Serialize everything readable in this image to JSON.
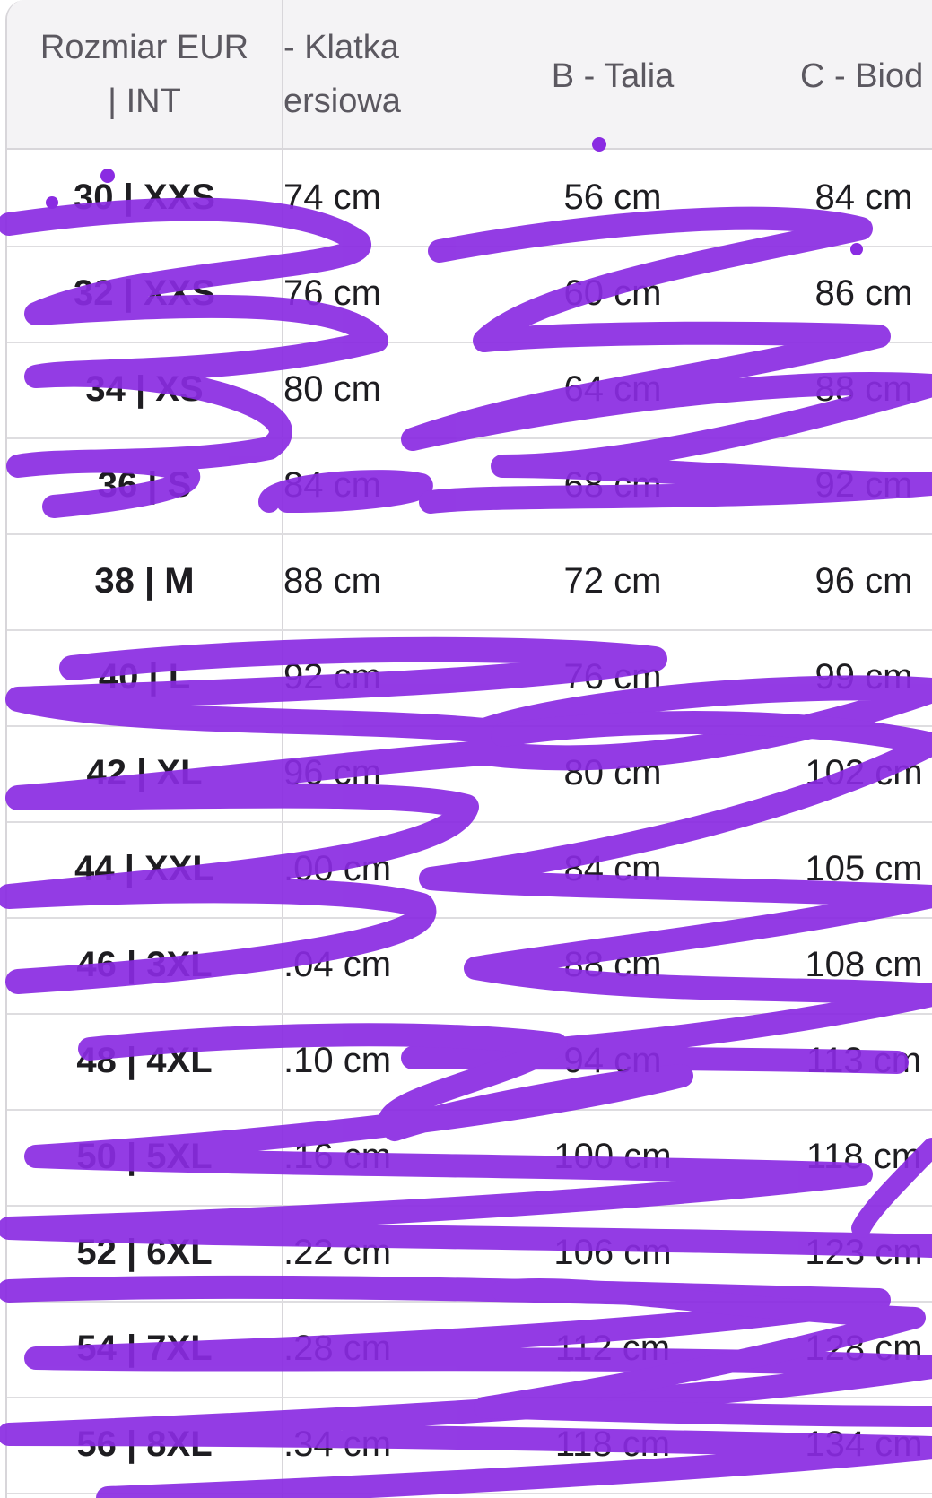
{
  "table": {
    "headers": [
      "Rozmiar EUR | INT",
      "- Klatka\nersiowa",
      "B - Talia",
      "C - Biod"
    ],
    "header_lines": {
      "col0": [
        "Rozmiar EUR",
        "| INT"
      ],
      "col1": [
        "- Klatka",
        "ersiowa"
      ],
      "col2": "B - Talia",
      "col3": "C - Biod"
    },
    "rows": [
      {
        "size": "30 | XXS",
        "chest": "74 cm",
        "waist": "56 cm",
        "hips": "84 cm"
      },
      {
        "size": "32 | XXS",
        "chest": "76 cm",
        "waist": "60 cm",
        "hips": "86 cm"
      },
      {
        "size": "34 | XS",
        "chest": "80 cm",
        "waist": "64 cm",
        "hips": "88 cm"
      },
      {
        "size": "36 | S",
        "chest": "84 cm",
        "waist": "68 cm",
        "hips": "92 cm"
      },
      {
        "size": "38 | M",
        "chest": "88 cm",
        "waist": "72 cm",
        "hips": "96 cm"
      },
      {
        "size": "40 | L",
        "chest": "92 cm",
        "waist": "76 cm",
        "hips": "99 cm"
      },
      {
        "size": "42 | XL",
        "chest": "96 cm",
        "waist": "80 cm",
        "hips": "102 cm"
      },
      {
        "size": "44 | XXL",
        "chest": ".00 cm",
        "waist": "84 cm",
        "hips": "105 cm"
      },
      {
        "size": "46 | 3XL",
        "chest": ".04 cm",
        "waist": "88 cm",
        "hips": "108 cm"
      },
      {
        "size": "48 | 4XL",
        "chest": ".10 cm",
        "waist": "94 cm",
        "hips": "113 cm"
      },
      {
        "size": "50 | 5XL",
        "chest": ".16 cm",
        "waist": "100 cm",
        "hips": "118 cm"
      },
      {
        "size": "52 | 6XL",
        "chest": ".22 cm",
        "waist": "106 cm",
        "hips": "123 cm"
      },
      {
        "size": "54 | 7XL",
        "chest": ".28 cm",
        "waist": "112 cm",
        "hips": "128 cm"
      },
      {
        "size": "56 | 8XL",
        "chest": ".34 cm",
        "waist": "118 cm",
        "hips": "134 cm"
      }
    ]
  },
  "colors": {
    "header_bg": "#f4f3f5",
    "grid": "#d8d6da",
    "text": "#1e1d21",
    "header_text": "#5b5860",
    "scribble": "#8a2be2"
  }
}
